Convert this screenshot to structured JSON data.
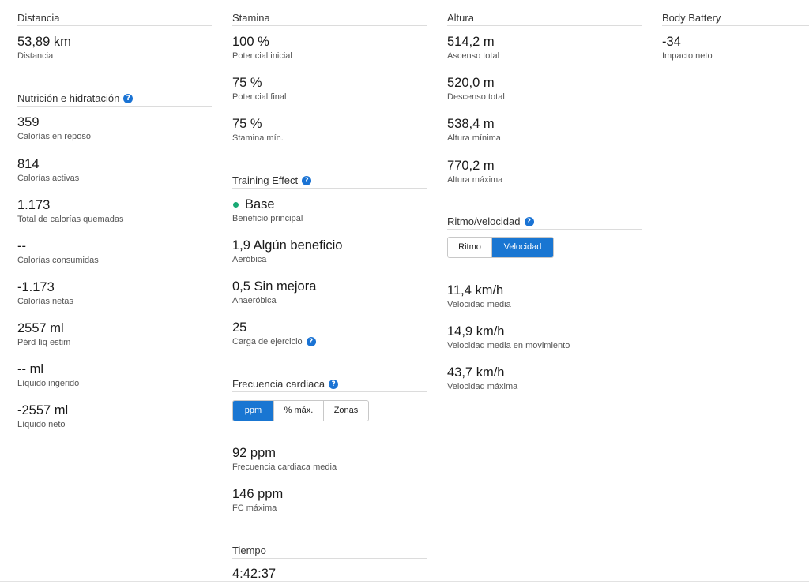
{
  "distancia": {
    "title": "Distancia",
    "value": "53,89 km",
    "label": "Distancia"
  },
  "nutricion": {
    "title": "Nutrición e hidratación",
    "items": [
      {
        "value": "359",
        "label": "Calorías en reposo"
      },
      {
        "value": "814",
        "label": "Calorías activas"
      },
      {
        "value": "1.173",
        "label": "Total de calorías quemadas"
      },
      {
        "value": "--",
        "label": "Calorías consumidas"
      },
      {
        "value": "-1.173",
        "label": "Calorías netas"
      },
      {
        "value": "2557 ml",
        "label": "Pérd líq estim"
      },
      {
        "value": "-- ml",
        "label": "Líquido ingerido"
      },
      {
        "value": "-2557 ml",
        "label": "Líquido neto"
      }
    ]
  },
  "stamina": {
    "title": "Stamina",
    "items": [
      {
        "value": "100 %",
        "label": "Potencial inicial"
      },
      {
        "value": "75 %",
        "label": "Potencial final"
      },
      {
        "value": "75 %",
        "label": "Stamina mín."
      }
    ]
  },
  "training_effect": {
    "title": "Training Effect",
    "items": [
      {
        "value": "Base",
        "label": "Beneficio principal"
      },
      {
        "value": "1,9 Algún beneficio",
        "label": "Aeróbica"
      },
      {
        "value": "0,5 Sin mejora",
        "label": "Anaeróbica"
      },
      {
        "value": "25",
        "label": "Carga de ejercicio"
      }
    ],
    "indicator_color": "#19a974"
  },
  "frecuencia": {
    "title": "Frecuencia cardiaca",
    "tabs": [
      "ppm",
      "% máx.",
      "Zonas"
    ],
    "active_tab": "ppm",
    "items": [
      {
        "value": "92 ppm",
        "label": "Frecuencia cardiaca media"
      },
      {
        "value": "146 ppm",
        "label": "FC máxima"
      }
    ]
  },
  "tiempo": {
    "title": "Tiempo",
    "value": "4:42:37"
  },
  "altura": {
    "title": "Altura",
    "items": [
      {
        "value": "514,2 m",
        "label": "Ascenso total"
      },
      {
        "value": "520,0 m",
        "label": "Descenso total"
      },
      {
        "value": "538,4 m",
        "label": "Altura mínima"
      },
      {
        "value": "770,2 m",
        "label": "Altura máxima"
      }
    ]
  },
  "ritmo": {
    "title": "Ritmo/velocidad",
    "tabs": [
      "Ritmo",
      "Velocidad"
    ],
    "active_tab": "Velocidad",
    "items": [
      {
        "value": "11,4 km/h",
        "label": "Velocidad media"
      },
      {
        "value": "14,9 km/h",
        "label": "Velocidad media en movimiento"
      },
      {
        "value": "43,7 km/h",
        "label": "Velocidad máxima"
      }
    ]
  },
  "body_battery": {
    "title": "Body Battery",
    "value": "-34",
    "label": "Impacto neto"
  },
  "help_glyph": "?",
  "colors": {
    "accent": "#1976d2",
    "help_icon": "#1a73d4"
  }
}
